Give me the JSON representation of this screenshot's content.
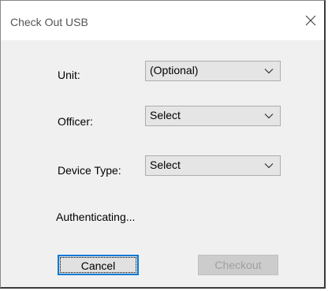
{
  "window": {
    "title": "Check Out USB"
  },
  "form": {
    "unit": {
      "label": "Unit:",
      "value": "(Optional)"
    },
    "officer": {
      "label": "Officer:",
      "value": "Select"
    },
    "device_type": {
      "label": "Device Type:",
      "value": "Select"
    }
  },
  "status": "Authenticating...",
  "buttons": {
    "cancel": "Cancel",
    "checkout": "Checkout",
    "checkout_enabled": false
  },
  "icons": {
    "close": "close-icon",
    "dropdown": "chevron-down-icon"
  }
}
